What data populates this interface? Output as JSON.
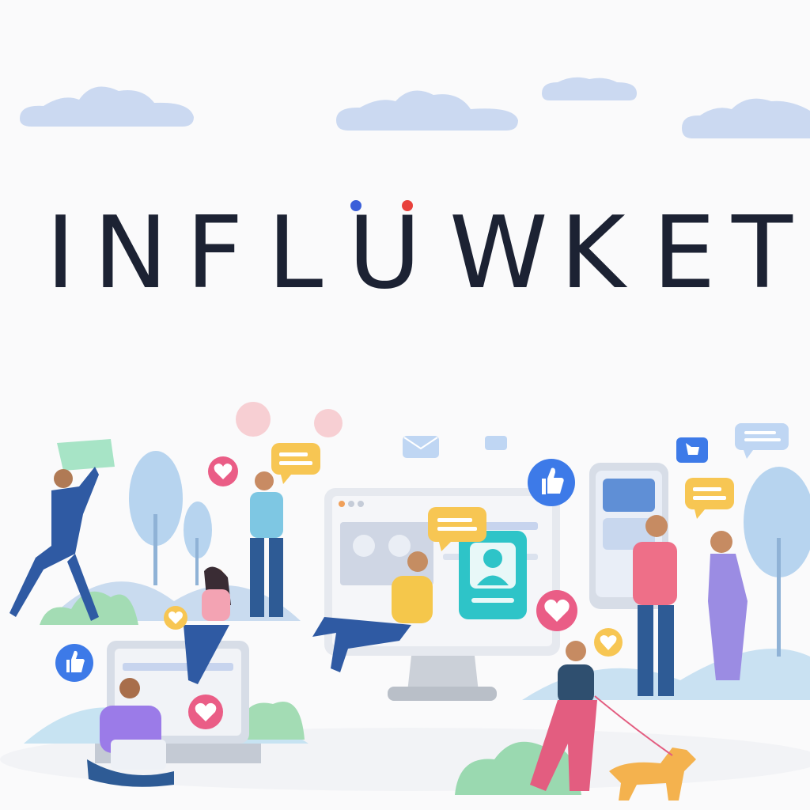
{
  "brand": {
    "wordmark": "INFLÜWKET",
    "letters": [
      "I",
      "N",
      "F",
      "L",
      "U",
      "W",
      "K",
      "E",
      "T"
    ],
    "umlaut_colors": [
      "#3b5fd9",
      "#e8413c"
    ],
    "text_color": "#1c2233"
  },
  "illustration": {
    "theme": "social media influencer community",
    "icons": [
      "like-icon",
      "heart-icon",
      "chat-bubble-icon",
      "mail-icon",
      "profile-card-icon"
    ],
    "accent_colors": {
      "like_blue": "#3d7ae8",
      "heart_pink": "#ea5d86",
      "chat_yellow": "#f7c653",
      "card_teal": "#2ec4c8",
      "tree_blue": "#b7d4ef",
      "bush_green": "#9ad9b0",
      "cloud": "#c9d8f0"
    }
  }
}
